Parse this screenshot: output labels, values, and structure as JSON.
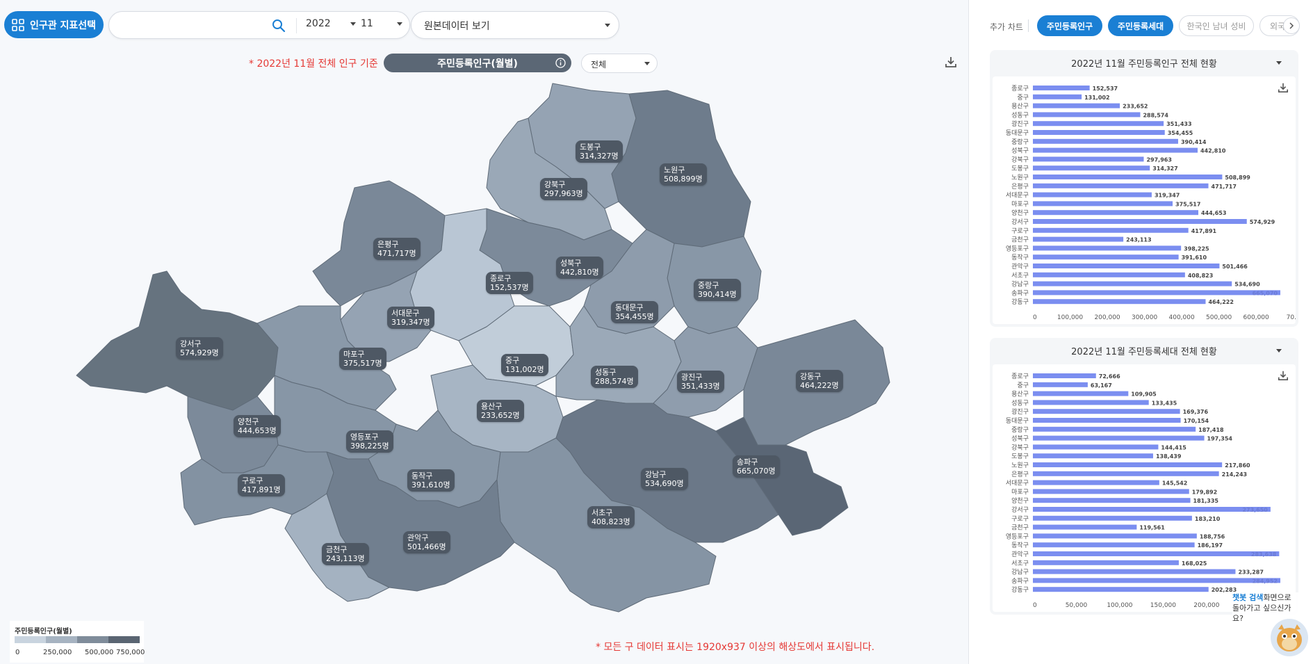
{
  "header": {
    "indicator_button": "인구관 지표선택",
    "search_placeholder": "",
    "year": "2022",
    "month": "11",
    "raw_data_select": "원본데이터 보기"
  },
  "map_header": {
    "basis_note": "* 2022년 11월 전체 인구 기준",
    "indicator_title": "주민등록인구(월별)",
    "filter_select": "전체"
  },
  "districts": [
    {
      "name": "도봉구",
      "value": "314,327명",
      "shade": "#95a3b3"
    },
    {
      "name": "노원구",
      "value": "508,899명",
      "shade": "#6e7c8c"
    },
    {
      "name": "강북구",
      "value": "297,963명",
      "shade": "#9aa8b7"
    },
    {
      "name": "은평구",
      "value": "471,717명",
      "shade": "#7a8898"
    },
    {
      "name": "성북구",
      "value": "442,810명",
      "shade": "#7c8a9a"
    },
    {
      "name": "종로구",
      "value": "152,537명",
      "shade": "#b9c6d4"
    },
    {
      "name": "중랑구",
      "value": "390,414명",
      "shade": "#8897a7"
    },
    {
      "name": "동대문구",
      "value": "354,455명",
      "shade": "#8e9cac"
    },
    {
      "name": "서대문구",
      "value": "319,347명",
      "shade": "#95a3b3"
    },
    {
      "name": "강서구",
      "value": "574,929명",
      "shade": "#66737f"
    },
    {
      "name": "마포구",
      "value": "375,517명",
      "shade": "#8a99a9"
    },
    {
      "name": "중구",
      "value": "131,002명",
      "shade": "#c1cdd9"
    },
    {
      "name": "성동구",
      "value": "288,574명",
      "shade": "#9ba9b8"
    },
    {
      "name": "광진구",
      "value": "351,433명",
      "shade": "#8f9dad"
    },
    {
      "name": "강동구",
      "value": "464,222명",
      "shade": "#7a8898"
    },
    {
      "name": "용산구",
      "value": "233,652명",
      "shade": "#a7b5c4"
    },
    {
      "name": "양천구",
      "value": "444,653명",
      "shade": "#7c8a9a"
    },
    {
      "name": "영등포구",
      "value": "398,225명",
      "shade": "#8796a6"
    },
    {
      "name": "동작구",
      "value": "391,610명",
      "shade": "#8897a7"
    },
    {
      "name": "구로구",
      "value": "417,891명",
      "shade": "#8392a2"
    },
    {
      "name": "강남구",
      "value": "534,690명",
      "shade": "#6b7888"
    },
    {
      "name": "송파구",
      "value": "665,070명",
      "shade": "#5a6675"
    },
    {
      "name": "서초구",
      "value": "408,823명",
      "shade": "#8594a4"
    },
    {
      "name": "관악구",
      "value": "501,466명",
      "shade": "#717f8f"
    },
    {
      "name": "금천구",
      "value": "243,113명",
      "shade": "#a4b2c1"
    }
  ],
  "legend": {
    "title": "주민등록인구(월별)",
    "ticks": [
      "0",
      "250,000",
      "500,000",
      "750,000"
    ],
    "colors": [
      "#c9d4df",
      "#a6b3c1",
      "#7f8c9a",
      "#5a6572"
    ]
  },
  "bottom_note": "* 모든 구 데이터 표시는 1920x937 이상의 해상도에서 표시됩니다.",
  "right_panel": {
    "label": "추가 차트",
    "chips": [
      {
        "label": "주민등록인구",
        "active": true
      },
      {
        "label": "주민등록세대",
        "active": true
      },
      {
        "label": "한국인 남녀 성비",
        "active": false
      },
      {
        "label": "외국",
        "active": false
      }
    ],
    "chart1_title": "2022년 11월 주민등록인구 전체 현황",
    "chart2_title": "2022년 11월 주민등록세대 전체 현황"
  },
  "chart_data": [
    {
      "type": "bar",
      "title": "2022년 11월 주민등록인구 전체 현황",
      "categories": [
        "종로구",
        "중구",
        "용산구",
        "성동구",
        "광진구",
        "동대문구",
        "중랑구",
        "성북구",
        "강북구",
        "도봉구",
        "노원구",
        "은평구",
        "서대문구",
        "마포구",
        "양천구",
        "강서구",
        "구로구",
        "금천구",
        "영등포구",
        "동작구",
        "관악구",
        "서초구",
        "강남구",
        "송파구",
        "강동구"
      ],
      "values": [
        152537,
        131002,
        233652,
        288574,
        351433,
        354455,
        390414,
        442810,
        297963,
        314327,
        508899,
        471717,
        319347,
        375517,
        444653,
        574929,
        417891,
        243113,
        398225,
        391610,
        501466,
        408823,
        534690,
        665070,
        464222
      ],
      "value_labels": [
        "152,537",
        "131,002",
        "233,652",
        "288,574",
        "351,433",
        "354,455",
        "390,414",
        "442,810",
        "297,963",
        "314,327",
        "508,899",
        "471,717",
        "319,347",
        "375,517",
        "444,653",
        "574,929",
        "417,891",
        "243,113",
        "398,225",
        "391,610",
        "501,466",
        "408,823",
        "534,690",
        "665,070",
        "464,222"
      ],
      "xticks": [
        "0",
        "100,000",
        "200,000",
        "300,000",
        "400,000",
        "500,000",
        "600,000",
        "70..."
      ],
      "xlim": [
        0,
        665070
      ],
      "color": "#7b8ef0"
    },
    {
      "type": "bar",
      "title": "2022년 11월 주민등록세대 전체 현황",
      "categories": [
        "종로구",
        "중구",
        "용산구",
        "성동구",
        "광진구",
        "동대문구",
        "중랑구",
        "성북구",
        "강북구",
        "도봉구",
        "노원구",
        "은평구",
        "서대문구",
        "마포구",
        "양천구",
        "강서구",
        "구로구",
        "금천구",
        "영등포구",
        "동작구",
        "관악구",
        "서초구",
        "강남구",
        "송파구",
        "강동구"
      ],
      "values": [
        72666,
        63167,
        109905,
        133435,
        169376,
        170154,
        187418,
        197354,
        144415,
        138439,
        217860,
        214243,
        145542,
        179892,
        181335,
        273650,
        183210,
        119561,
        188756,
        186197,
        283638,
        168025,
        233287,
        284952,
        202283
      ],
      "value_labels": [
        "72,666",
        "63,167",
        "109,905",
        "133,435",
        "169,376",
        "170,154",
        "187,418",
        "197,354",
        "144,415",
        "138,439",
        "217,860",
        "214,243",
        "145,542",
        "179,892",
        "181,335",
        "273,650",
        "183,210",
        "119,561",
        "188,756",
        "186,197",
        "283,638",
        "168,025",
        "233,287",
        "284,952",
        "202,283"
      ],
      "xticks": [
        "0",
        "50,000",
        "100,000",
        "150,000",
        "200,000"
      ],
      "xlim": [
        0,
        284952
      ],
      "color": "#7b8ef0"
    }
  ],
  "chatbot": {
    "highlight": "챗봇 검색",
    "text1": "화면으로",
    "text2": "돌아가고 싶으신가요?"
  }
}
